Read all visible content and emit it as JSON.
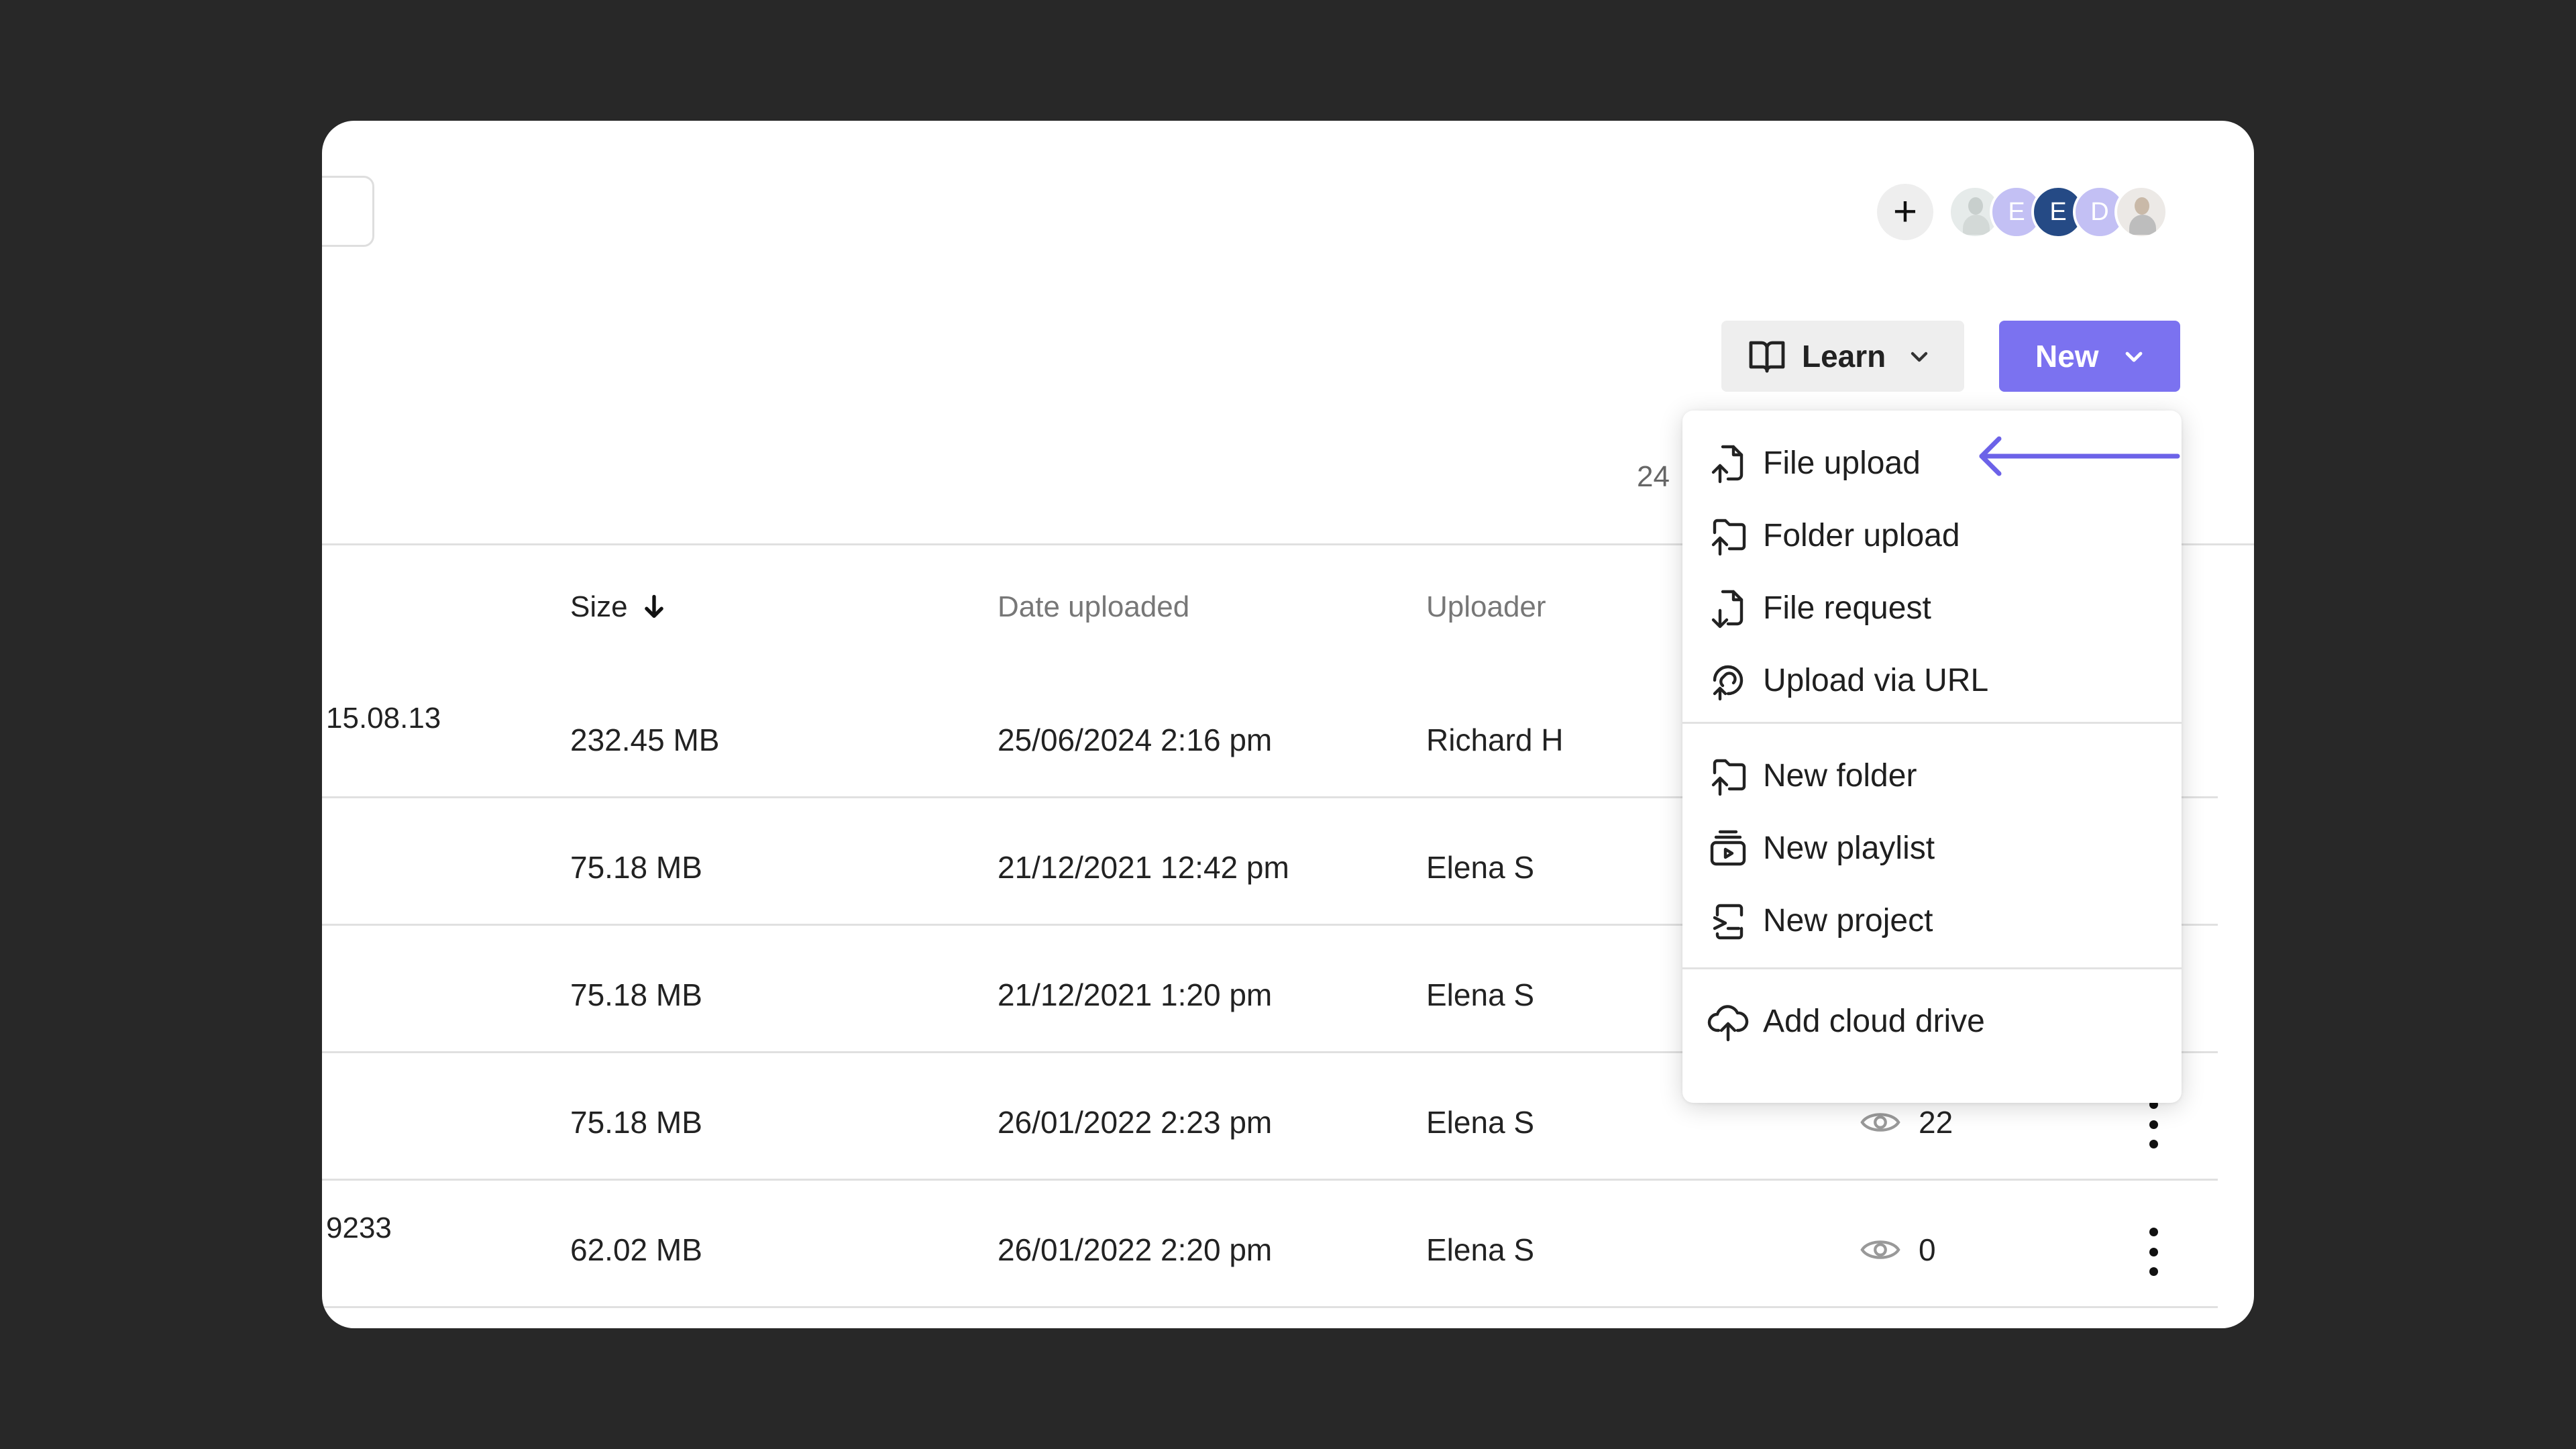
{
  "colors": {
    "backdrop": "#282828",
    "accent": "#7b72f0",
    "annotation_arrow": "#6c62e8"
  },
  "header": {
    "add_member_icon": "plus-icon",
    "avatars": [
      {
        "kind": "photo",
        "initial": ""
      },
      {
        "kind": "initial",
        "initial": "E",
        "color": "#c3c0f4"
      },
      {
        "kind": "initial",
        "initial": "E",
        "color": "#254a85"
      },
      {
        "kind": "initial",
        "initial": "D",
        "color": "#c3c0f4"
      },
      {
        "kind": "photo",
        "initial": ""
      }
    ]
  },
  "toolbar": {
    "learn_label": "Learn",
    "learn_icon": "book-icon",
    "new_label": "New",
    "item_count": "24"
  },
  "table": {
    "columns": {
      "size": "Size",
      "date": "Date uploaded",
      "uploader": "Uploader"
    },
    "sort_icon": "arrow-down-icon",
    "rows": [
      {
        "name": "15.08.13",
        "size": "232.45 MB",
        "date": "25/06/2024 2:16 pm",
        "uploader": "Richard H",
        "views": ""
      },
      {
        "name": "",
        "size": "75.18 MB",
        "date": "21/12/2021 12:42 pm",
        "uploader": "Elena S",
        "views": ""
      },
      {
        "name": "",
        "size": "75.18 MB",
        "date": "21/12/2021 1:20 pm",
        "uploader": "Elena S",
        "views": ""
      },
      {
        "name": "",
        "size": "75.18 MB",
        "date": "26/01/2022 2:23 pm",
        "uploader": "Elena S",
        "views": "22"
      },
      {
        "name": "9233",
        "size": "62.02 MB",
        "date": "26/01/2022 2:20 pm",
        "uploader": "Elena S",
        "views": "0"
      }
    ]
  },
  "new_menu": {
    "items": [
      {
        "label": "File upload",
        "icon": "file-upload-icon"
      },
      {
        "label": "Folder upload",
        "icon": "folder-upload-icon"
      },
      {
        "label": "File request",
        "icon": "file-request-icon"
      },
      {
        "label": "Upload via URL",
        "icon": "link-upload-icon"
      },
      {
        "label": "New folder",
        "icon": "new-folder-icon"
      },
      {
        "label": "New playlist",
        "icon": "playlist-icon"
      },
      {
        "label": "New project",
        "icon": "project-icon"
      },
      {
        "label": "Add cloud drive",
        "icon": "cloud-upload-icon"
      }
    ]
  }
}
